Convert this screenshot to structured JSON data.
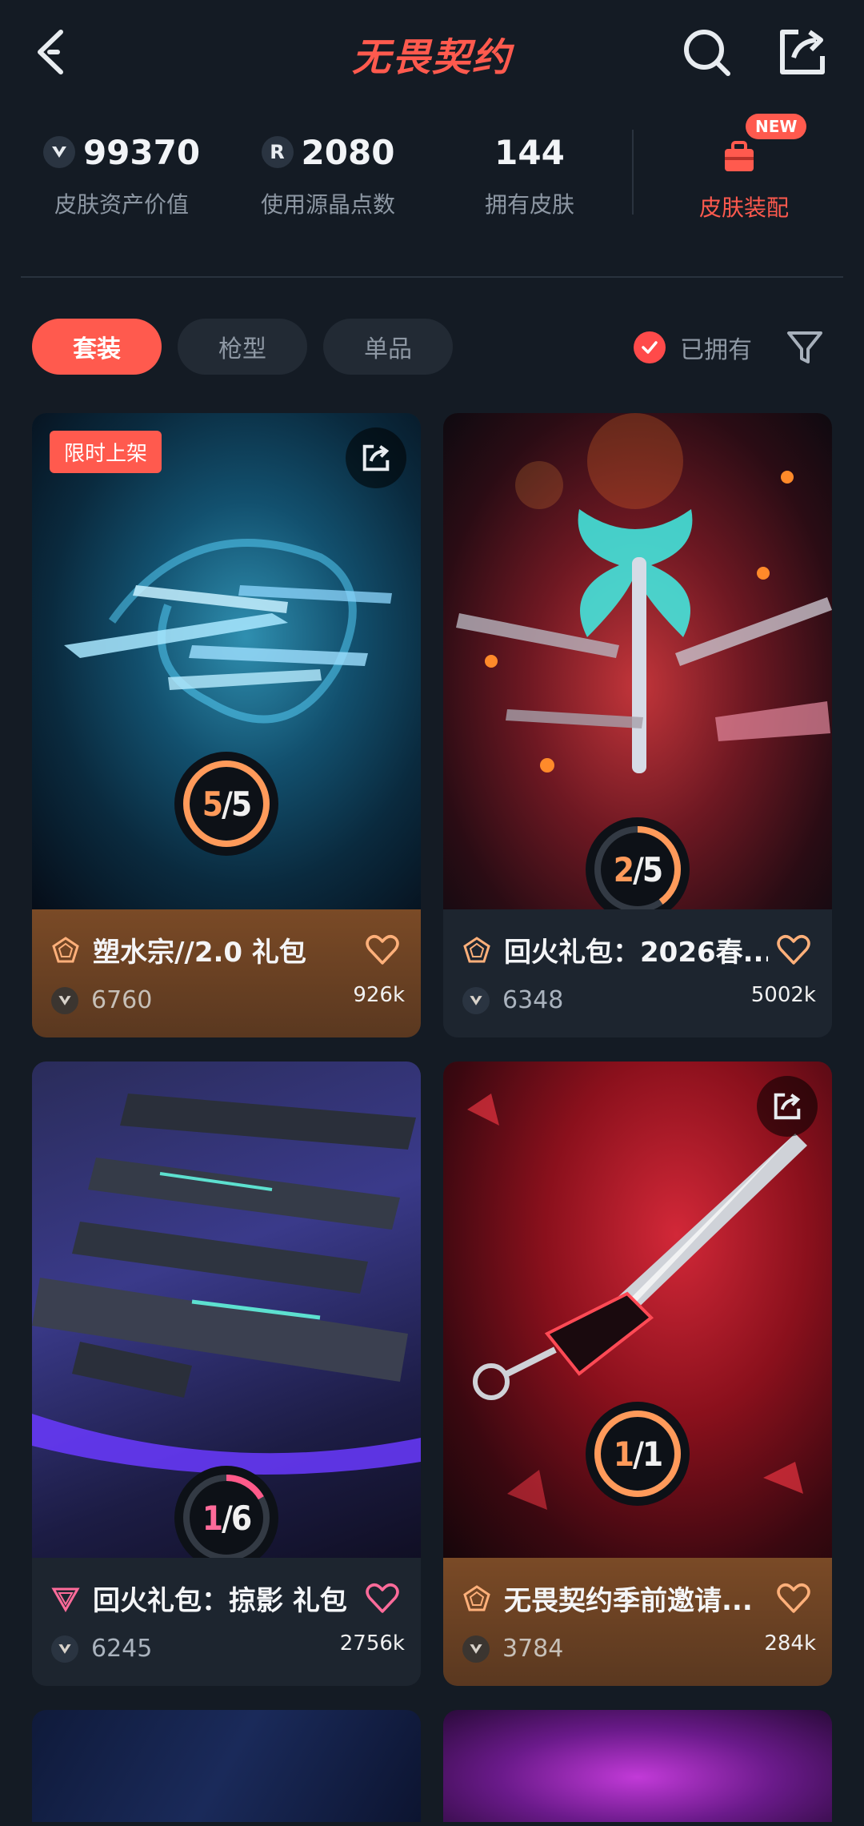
{
  "header": {
    "title": "无畏契约"
  },
  "stats": {
    "asset_value": {
      "value": "99370",
      "label": "皮肤资产价值"
    },
    "radianite": {
      "value": "2080",
      "label": "使用源晶点数"
    },
    "owned_skins": {
      "value": "144",
      "label": "拥有皮肤"
    },
    "loadout": {
      "label": "皮肤装配",
      "badge": "NEW"
    }
  },
  "tabs": [
    {
      "label": "套装",
      "active": true
    },
    {
      "label": "枪型",
      "active": false
    },
    {
      "label": "单品",
      "active": false
    }
  ],
  "owned_filter": {
    "label": "已拥有",
    "checked": true
  },
  "cards": [
    {
      "name": "塑水宗//2.0 礼包",
      "price": "6760",
      "likes": "926k",
      "progress_owned": "5",
      "progress_total": "5",
      "fraction": 1.0,
      "tag": "限时上架",
      "tier_color": "#ffb07a",
      "theme": "gold"
    },
    {
      "name": "回火礼包：2026春...",
      "price": "6348",
      "likes": "5002k",
      "progress_owned": "2",
      "progress_total": "5",
      "fraction": 0.4,
      "theme": "dark",
      "tier_color": "#ffb07a"
    },
    {
      "name": "回火礼包：掠影 礼包",
      "price": "6245",
      "likes": "2756k",
      "progress_owned": "1",
      "progress_total": "6",
      "fraction": 0.1667,
      "theme": "dark",
      "tier_color": "#ff6b9a"
    },
    {
      "name": "无畏契约季前邀请...",
      "price": "3784",
      "likes": "284k",
      "progress_owned": "1",
      "progress_total": "1",
      "fraction": 1.0,
      "theme": "gold",
      "tier_color": "#ffb07a"
    }
  ],
  "colors": {
    "accent": "#ff5a4e",
    "background": "#141b24",
    "gold_card": "#7a4a26"
  }
}
